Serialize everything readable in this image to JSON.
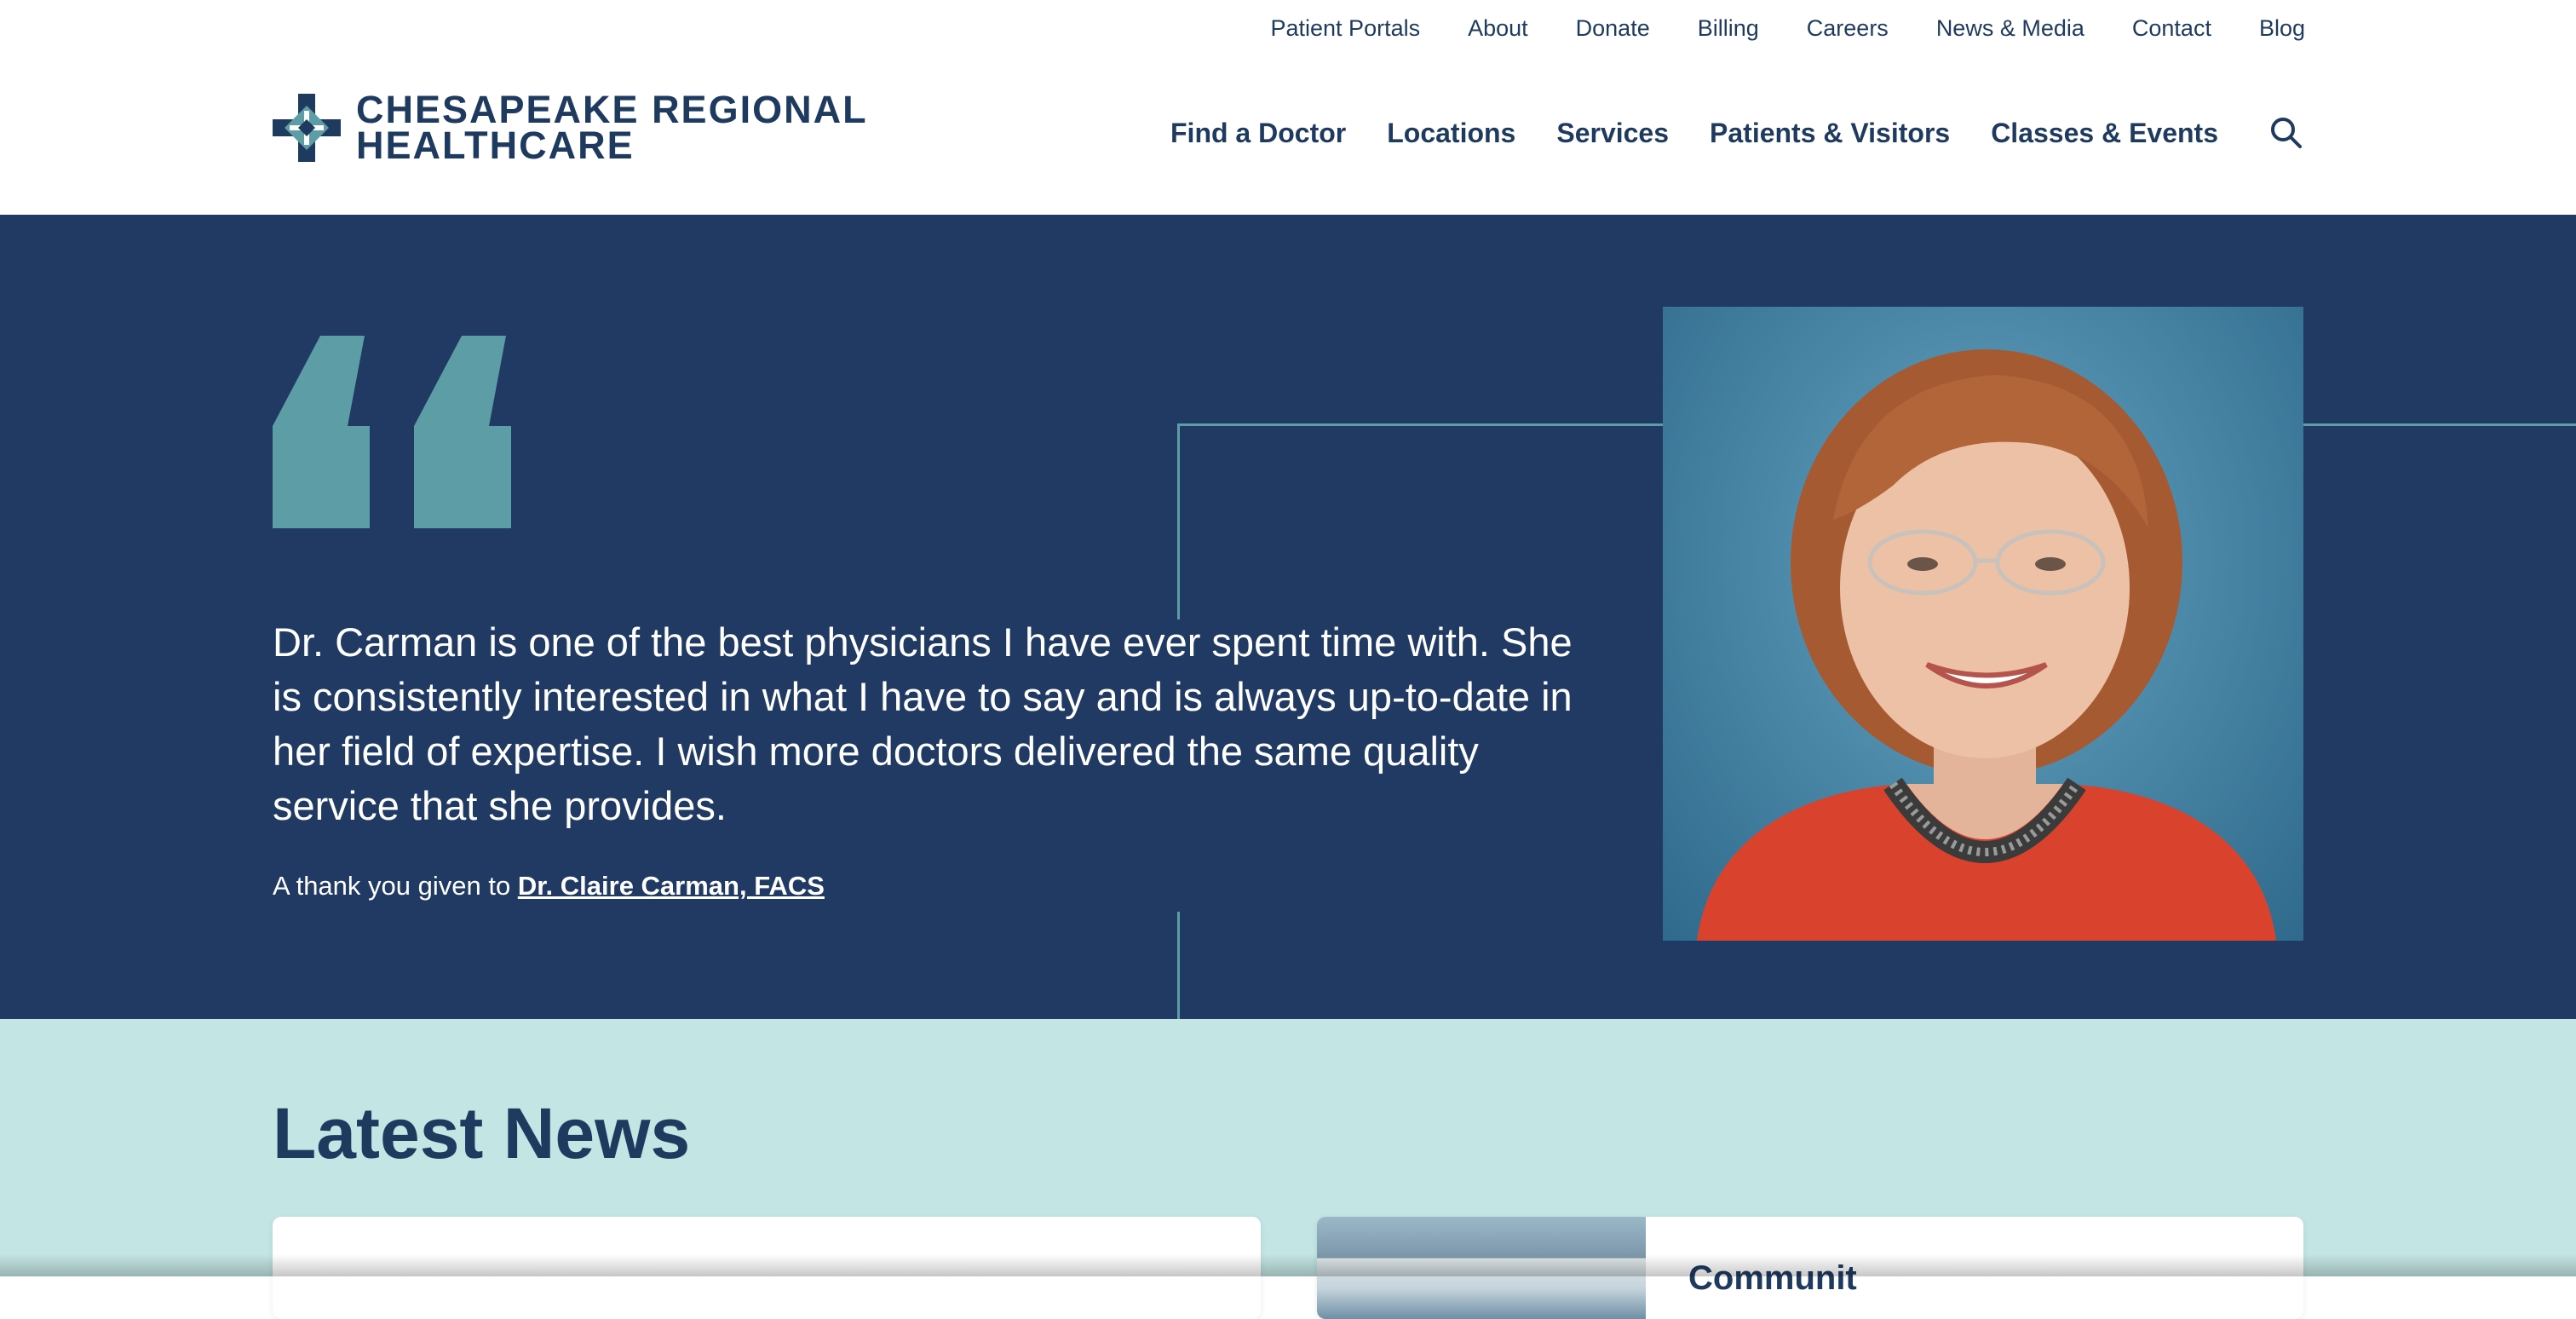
{
  "header": {
    "utility_nav": [
      "Patient Portals",
      "About",
      "Donate",
      "Billing",
      "Careers",
      "News & Media",
      "Contact",
      "Blog"
    ],
    "logo": {
      "line1": "CHESAPEAKE REGIONAL",
      "line2": "HEALTHCARE"
    },
    "main_nav": [
      "Find a Doctor",
      "Locations",
      "Services",
      "Patients & Visitors",
      "Classes & Events"
    ],
    "search_icon": "search-icon"
  },
  "testimonial": {
    "quote": "Dr. Carman is one of the best physicians I have ever spent time with. She is consistently interested in what I have to say and is always up-to-date in her field of expertise. I wish more doctors delivered the same quality service that she provides.",
    "thanks_prefix": "A thank you given to ",
    "doctor_link": "Dr. Claire Carman, FACS",
    "quote_icon": "quote-icon",
    "colors": {
      "background": "#203a63",
      "accent": "#5d9ea6"
    }
  },
  "news": {
    "title": "Latest News",
    "cards": [
      {
        "tag": ""
      },
      {
        "tag": "Communit"
      }
    ],
    "colors": {
      "background": "#c3e5e4"
    }
  },
  "colors": {
    "brand_navy": "#1f3a5f"
  }
}
